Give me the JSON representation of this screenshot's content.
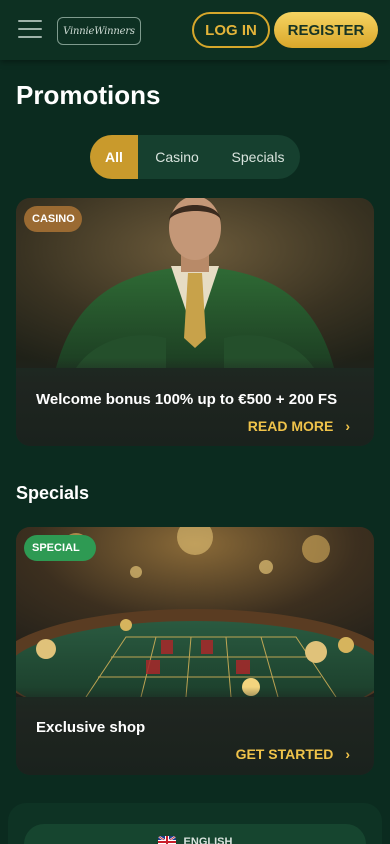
{
  "header": {
    "menu_icon": "hamburger-menu-icon",
    "logo_text": "VinnieWinners",
    "login_label": "LOG IN",
    "register_label": "REGISTER"
  },
  "page": {
    "title": "Promotions"
  },
  "tabs": [
    {
      "label": "All",
      "active": true
    },
    {
      "label": "Casino",
      "active": false
    },
    {
      "label": "Specials",
      "active": false
    }
  ],
  "promo_cards": [
    {
      "badge": "CASINO",
      "title": "Welcome bonus 100% up to €500 + 200 FS",
      "link_label": "READ MORE",
      "image": "man-in-green-suit-illustration"
    }
  ],
  "specials": {
    "section_title": "Specials",
    "cards": [
      {
        "badge": "SPECIAL",
        "title": "Exclusive shop",
        "link_label": "GET STARTED",
        "image": "roulette-table-illustration"
      }
    ]
  },
  "footer": {
    "language_label": "ENGLISH",
    "flag_icon": "uk-flag-icon"
  },
  "colors": {
    "background": "#0b2b1f",
    "accent_gold": "#e3b43a",
    "badge_casino": "#9a6a32",
    "badge_special": "#2e9a53"
  }
}
